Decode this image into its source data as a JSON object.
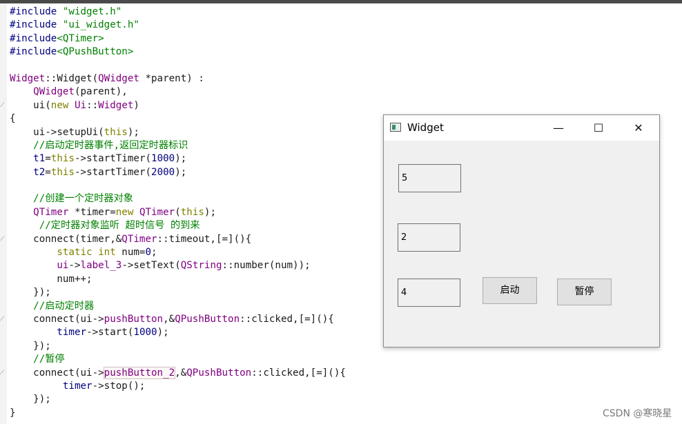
{
  "code": {
    "l1": {
      "a": "#include ",
      "b": "\"widget.h\""
    },
    "l2": {
      "a": "#include ",
      "b": "\"ui_widget.h\""
    },
    "l3": {
      "a": "#include",
      "b": "<QTimer>"
    },
    "l4": {
      "a": "#include",
      "b": "<QPushButton>"
    },
    "l6": {
      "a": "Widget",
      "b": "::Widget(",
      "c": "QWidget",
      "d": " *parent) :"
    },
    "l7": {
      "a": "    ",
      "b": "QWidget",
      "c": "(parent),"
    },
    "l8": {
      "a": "    ui(",
      "b": "new",
      "c": " ",
      "d": "Ui",
      "e": "::",
      "f": "Widget",
      "g": ")"
    },
    "l9": "{",
    "l10": {
      "a": "    ui->setupUi(",
      "b": "this",
      "c": ");"
    },
    "l11": "    //启动定时器事件,返回定时器标识",
    "l12": {
      "a": "    ",
      "b": "t1",
      "c": "=",
      "d": "this",
      "e": "->startTimer(",
      "f": "1000",
      "g": ");"
    },
    "l13": {
      "a": "    ",
      "b": "t2",
      "c": "=",
      "d": "this",
      "e": "->startTimer(",
      "f": "2000",
      "g": ");"
    },
    "l15": "    //创建一个定时器对象",
    "l16": {
      "a": "    ",
      "b": "QTimer",
      "c": " *timer=",
      "d": "new",
      "e": " ",
      "f": "QTimer",
      "g": "(",
      "h": "this",
      "i": ");"
    },
    "l17": "     //定时器对象监听 超时信号 的到来",
    "l18": {
      "a": "    connect(timer,&",
      "b": "QTimer",
      "c": "::timeout,[=](){"
    },
    "l19": {
      "a": "        ",
      "b": "static",
      "c": " ",
      "d": "int",
      "e": " num=",
      "f": "0",
      "g": ";"
    },
    "l20": {
      "a": "        ",
      "b": "ui",
      "c": "->",
      "d": "label_3",
      "e": "->setText(",
      "f": "QString",
      "g": "::number(num));"
    },
    "l21": "        num++;",
    "l22": "    });",
    "l23": "    //启动定时器",
    "l24": {
      "a": "    connect(ui->",
      "b": "pushButton",
      "c": ",&",
      "d": "QPushButton",
      "e": "::clicked,[=](){"
    },
    "l25": {
      "a": "        ",
      "b": "timer",
      "c": "->start(",
      "d": "1000",
      "e": ");"
    },
    "l26": "    });",
    "l27": "    //暂停",
    "l28": {
      "a": "    connect(ui->",
      "b": "pushButton_2",
      "c": ",&",
      "d": "QPushButton",
      "e": "::clicked,[=](){"
    },
    "l29": {
      "a": "         ",
      "b": "timer",
      "c": "->stop();"
    },
    "l30": "    });",
    "l31": "}"
  },
  "window": {
    "title": "Widget",
    "minimize_glyph": "—",
    "maximize_glyph": "☐",
    "close_glyph": "✕",
    "label_1": "5",
    "label_2": "2",
    "label_3": "4",
    "start_button": "启动",
    "pause_button": "暂停"
  },
  "watermark": "CSDN @寒晓星",
  "colors": {
    "preprocessor": "#000080",
    "string": "#008000",
    "type": "#800080",
    "keyword": "#808000",
    "number": "#000080",
    "comment": "#008000"
  }
}
